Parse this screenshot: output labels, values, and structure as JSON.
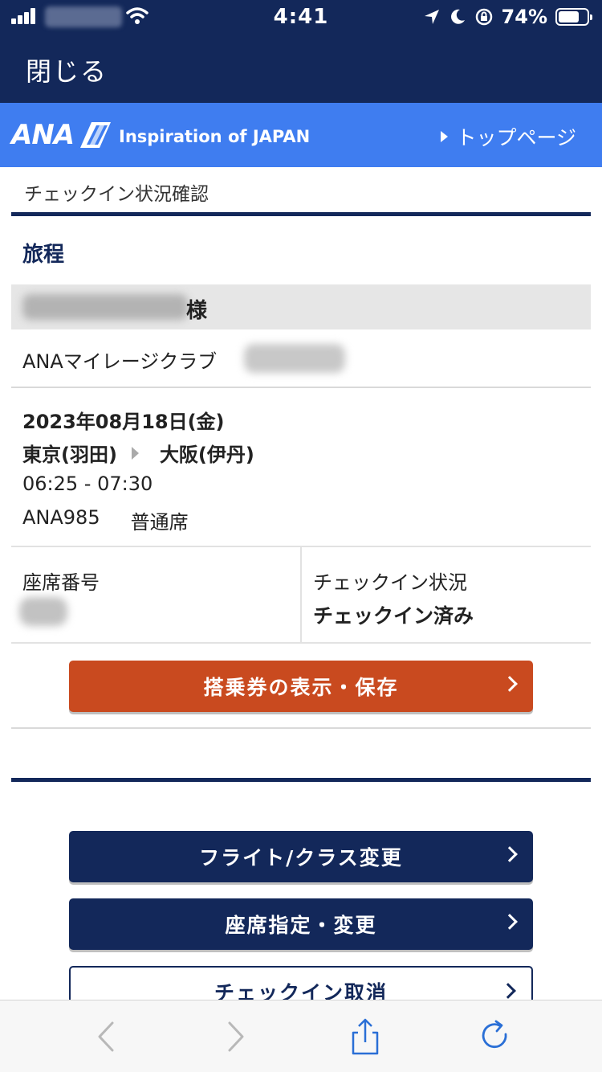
{
  "status_bar": {
    "time": "4:41",
    "battery_text": "74%",
    "battery_level": 0.74
  },
  "nav": {
    "close_label": "閉じる"
  },
  "brand": {
    "logo_text": "ANA",
    "tagline": "Inspiration of JAPAN",
    "top_page_link": "トップページ"
  },
  "page": {
    "label": "チェックイン状況確認",
    "section_title": "旅程",
    "name_suffix": "様",
    "mileage_label": "ANAマイレージクラブ"
  },
  "flight": {
    "date": "2023年08月18日(金)",
    "origin": "東京(羽田)",
    "destination": "大阪(伊丹)",
    "time": "06:25 - 07:30",
    "number": "ANA985",
    "cabin": "普通席"
  },
  "seat": {
    "seat_label": "座席番号",
    "checkin_label": "チェックイン状況",
    "checkin_value": "チェックイン済み"
  },
  "buttons": {
    "boarding_pass": "搭乗券の表示・保存",
    "flight_change": "フライト/クラス変更",
    "seat_change": "座席指定・変更",
    "cancel_checkin": "チェックイン取消"
  },
  "colors": {
    "navy": "#13285a",
    "brand_blue": "#3f7df0",
    "orange": "#c94a1f"
  },
  "toolbar": {
    "icons": [
      "back-icon",
      "forward-icon",
      "share-icon",
      "reload-icon"
    ]
  }
}
